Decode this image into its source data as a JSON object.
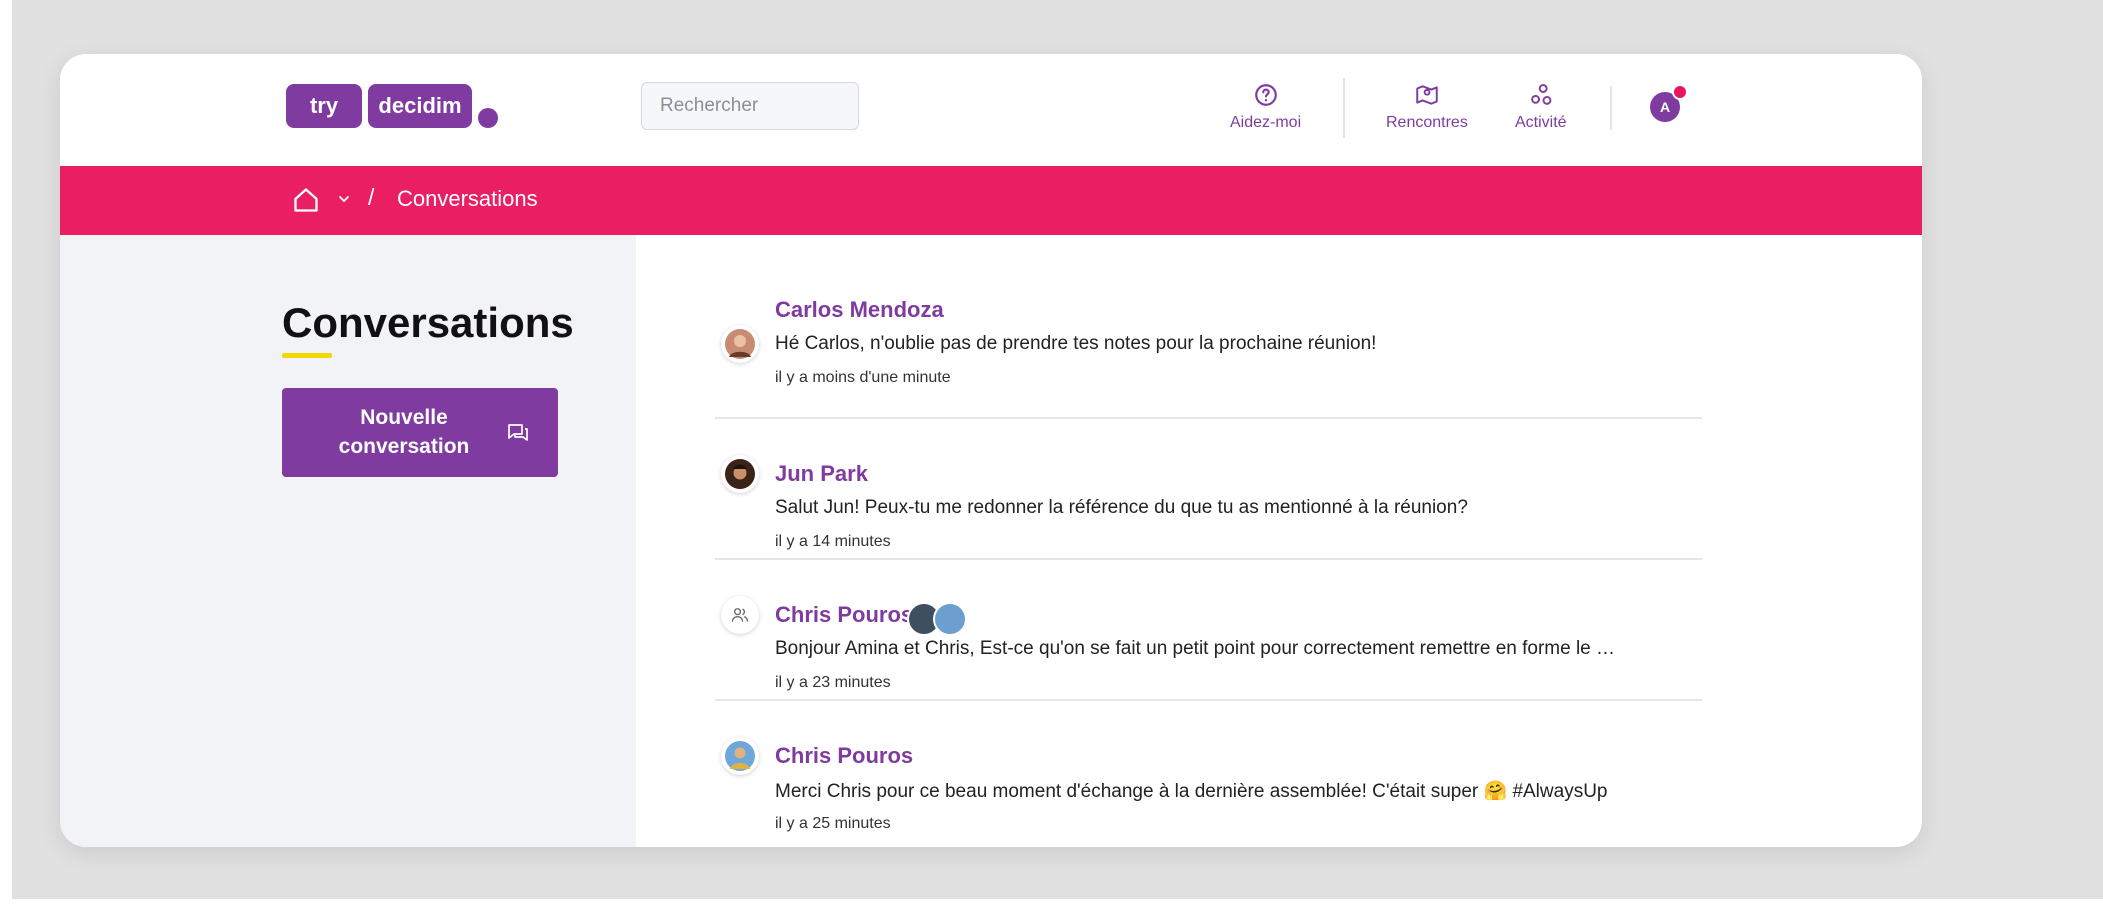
{
  "header": {
    "logo": {
      "part1": "try",
      "part2": "decidim"
    },
    "search": {
      "placeholder": "Rechercher"
    },
    "nav": [
      {
        "label": "Aidez-moi",
        "icon": "help-circle-icon"
      },
      {
        "label": "Rencontres",
        "icon": "map-pin-icon"
      },
      {
        "label": "Activité",
        "icon": "activity-icon"
      }
    ],
    "user": {
      "initial": "A"
    }
  },
  "breadcrumb": {
    "separator": "/",
    "current": "Conversations"
  },
  "sidebar": {
    "title": "Conversations",
    "new_button": "Nouvelle conversation"
  },
  "conversations": [
    {
      "name": "Carlos Mendoza",
      "message": "Hé Carlos, n'oublie pas de prendre tes notes pour la prochaine réunion!",
      "time": "il y a moins d'une minute",
      "avatar": "photo"
    },
    {
      "name": "Jun Park",
      "message": "Salut Jun! Peux-tu me redonner la référence du que tu as mentionné à la réunion?",
      "time": "il y a 14 minutes",
      "avatar": "photo"
    },
    {
      "name": "Chris Pouros",
      "message": "Bonjour Amina et Chris, Est-ce qu'on se fait un petit point pour correctement remettre en forme le …",
      "time": "il y a 23 minutes",
      "avatar": "group-icon"
    },
    {
      "name": "Chris Pouros",
      "message": "Merci Chris pour ce beau moment d'échange à la dernière assemblée! C'était super 🤗 #AlwaysUp",
      "time": "il y a 25 minutes",
      "avatar": "photo"
    }
  ],
  "colors": {
    "brand": "#7f3b9f",
    "accent": "#e91e63",
    "underline": "#f1d800"
  }
}
